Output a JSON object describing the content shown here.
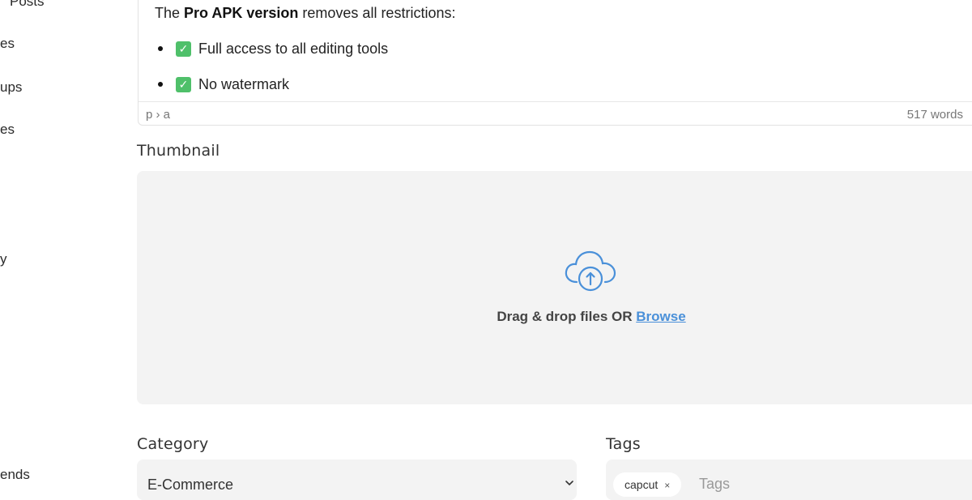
{
  "sidebar": {
    "items": [
      {
        "label": "Posts"
      },
      {
        "label": "es"
      },
      {
        "label": "ups"
      },
      {
        "label": "es"
      },
      {
        "label": "y"
      },
      {
        "label": "ends"
      }
    ]
  },
  "editor": {
    "intro_prefix": "The ",
    "intro_bold": "Pro APK version",
    "intro_suffix": " removes all restrictions:",
    "bullets": [
      {
        "icon": "check-mark-icon",
        "text": "Full access to all editing tools"
      },
      {
        "icon": "check-mark-icon",
        "text": "No watermark"
      }
    ],
    "path": "p › a",
    "word_count": "517 words"
  },
  "thumbnail": {
    "label": "Thumbnail",
    "drop_text": "Drag & drop files OR ",
    "browse_label": "Browse",
    "icon": "cloud-upload-icon"
  },
  "category": {
    "label": "Category",
    "value": "E-Commerce"
  },
  "tags": {
    "label": "Tags",
    "chips": [
      {
        "label": "capcut",
        "remove": "×"
      }
    ],
    "placeholder": "Tags"
  },
  "colors": {
    "accent": "#4a90d9",
    "check": "#4fc06a",
    "panel_bg": "#f3f3f3"
  }
}
